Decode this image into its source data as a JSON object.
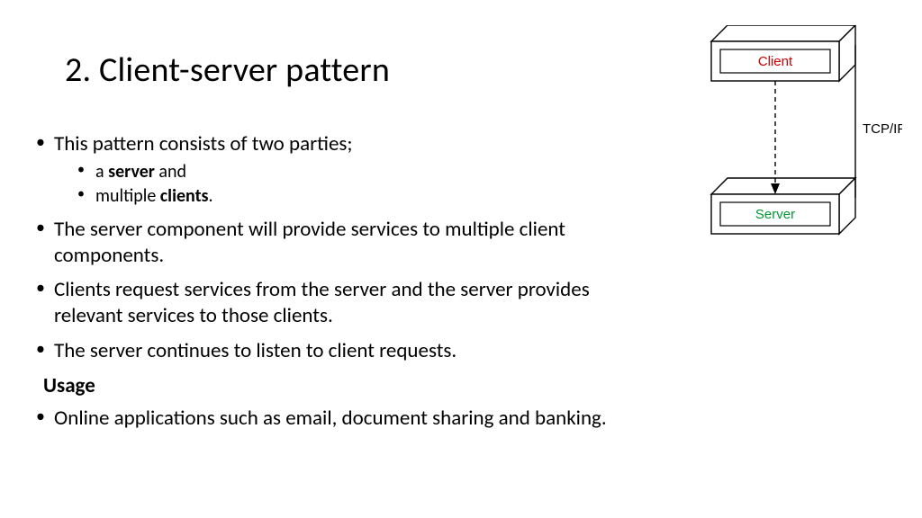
{
  "title": "2. Client-server pattern",
  "bullets": {
    "b1": "This pattern consists of two parties;",
    "b1a_pre": " a ",
    "b1a_bold": "server",
    "b1a_post": " and",
    "b1b_pre": "multiple ",
    "b1b_bold": "clients",
    "b1b_post": ".",
    "b2": "The server component will provide services to multiple client components.",
    "b3": " Clients request services from the server and the server provides relevant services to those clients.",
    "b4": "The server continues to listen to client requests."
  },
  "usage_heading": "Usage",
  "usage1": "Online applications such as email, document sharing and banking.",
  "diagram": {
    "client_label": "Client",
    "server_label": "Server",
    "link_label": "TCP/IP"
  }
}
